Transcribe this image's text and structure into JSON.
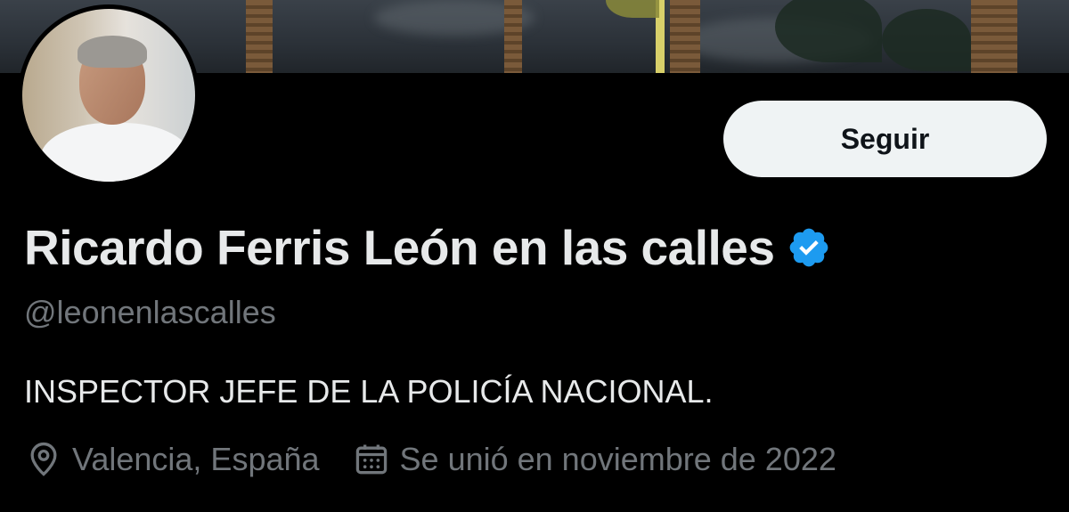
{
  "banner": {
    "icon": "palm-trees-banner-image"
  },
  "avatar": {
    "icon": "profile-photo"
  },
  "profile": {
    "follow_label": "Seguir",
    "display_name": "Ricardo Ferris León en las calles",
    "verified_icon": "verified-badge-icon",
    "handle": "@leonenlascalles",
    "bio": "INSPECTOR JEFE DE LA POLICÍA NACIONAL.",
    "location": "Valencia, España",
    "location_icon": "location-pin-icon",
    "joined": "Se unió en noviembre de 2022",
    "joined_icon": "calendar-icon"
  },
  "colors": {
    "background": "#000000",
    "primary_text": "#e7e9ea",
    "secondary_text": "#71767b",
    "button_bg": "#eff3f4",
    "verified_blue": "#1d9bf0"
  }
}
